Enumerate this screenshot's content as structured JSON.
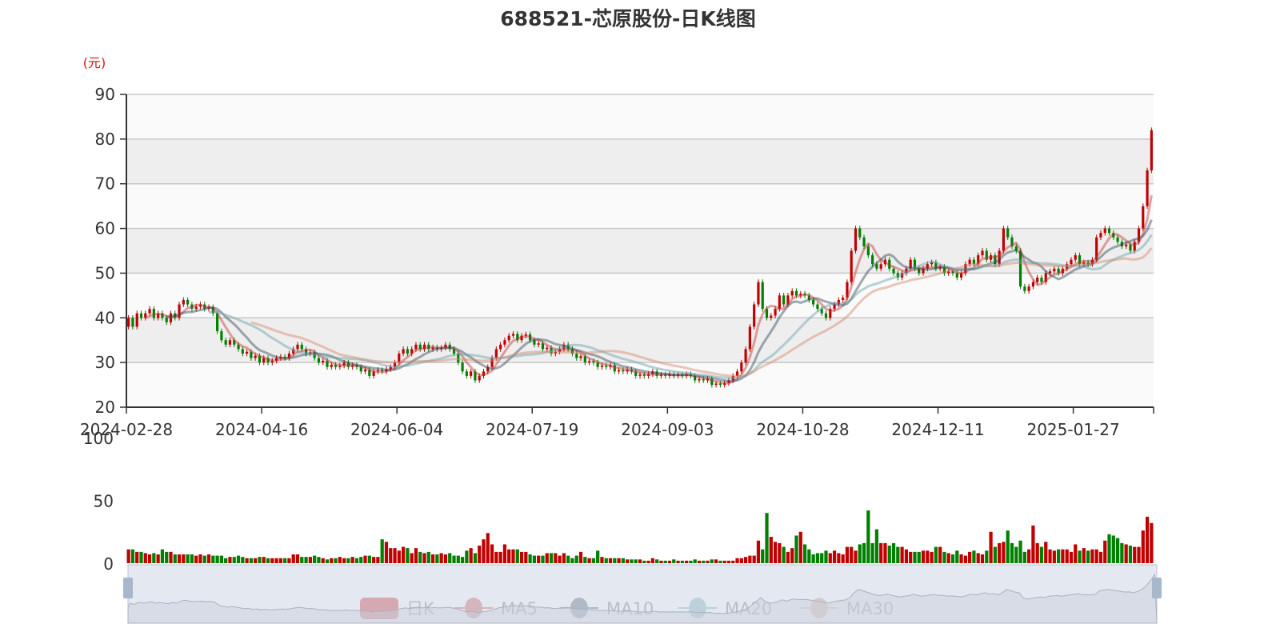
{
  "chart_data": {
    "type": "candlestick",
    "title": "688521-芯原股份-日K线图",
    "ylabel": "(元)",
    "ylim": [
      20,
      90
    ],
    "y_ticks": [
      "20",
      "30",
      "40",
      "50",
      "60",
      "70",
      "80",
      "90"
    ],
    "volume_ylim": [
      0,
      100
    ],
    "volume_ticks": [
      "0",
      "50",
      "100"
    ],
    "x_tick_labels": [
      "2024-02-28",
      "2024-04-16",
      "2024-06-04",
      "2024-07-19",
      "2024-09-03",
      "2024-10-28",
      "2024-12-11",
      "2025-01-27"
    ],
    "x_tick_interval": 32,
    "legend": [
      "日K",
      "MA5",
      "MA10",
      "MA20",
      "MA30"
    ],
    "legend_position": "bottom",
    "grid": true,
    "ma_periods": [
      5,
      10,
      20,
      30
    ],
    "close": [
      40,
      38,
      41,
      40,
      41,
      42,
      40,
      41,
      40,
      39,
      41,
      40,
      43,
      44,
      43,
      42,
      42.5,
      43,
      42,
      42.4,
      41,
      37,
      35,
      34,
      35,
      34,
      33,
      32,
      32.4,
      31,
      31.5,
      30,
      31,
      30,
      30.4,
      31,
      31.3,
      31,
      32,
      33,
      34,
      33,
      32,
      32.3,
      31,
      30,
      30.4,
      29,
      29.5,
      29,
      29.3,
      30,
      29,
      29.4,
      29,
      28,
      28.4,
      27,
      28,
      28.3,
      28,
      28.5,
      29,
      30,
      32,
      33,
      32,
      33,
      34,
      33,
      34,
      33,
      33.4,
      33,
      33.3,
      34,
      33,
      32,
      30,
      28,
      27,
      28,
      26,
      27,
      28,
      29,
      31,
      33,
      34,
      35,
      36,
      36.4,
      35,
      36,
      36.3,
      35,
      34,
      34.3,
      33,
      33.3,
      32,
      32.4,
      33,
      34,
      33,
      32,
      31,
      31.4,
      30,
      30.3,
      30,
      29,
      29.3,
      29,
      29.4,
      28,
      28.3,
      28,
      28.4,
      28,
      27,
      27.3,
      27,
      27.4,
      28,
      27,
      27.3,
      27,
      27.4,
      27,
      27.3,
      27,
      27.4,
      27,
      26,
      26.3,
      26,
      26.4,
      25,
      25.3,
      25,
      25.4,
      26,
      27,
      28,
      30,
      33,
      38,
      43,
      48,
      42,
      40,
      40.5,
      42,
      45,
      43,
      45,
      46,
      45,
      45.4,
      45,
      44,
      43,
      42,
      41,
      40,
      42,
      43,
      44,
      44.5,
      48,
      55,
      60,
      58,
      56,
      54,
      52,
      51,
      52,
      53,
      51,
      50,
      49,
      50,
      51,
      53,
      51,
      50,
      51,
      52,
      52.4,
      51,
      51.4,
      50,
      50.4,
      50,
      49,
      50,
      52,
      53,
      52,
      54,
      55,
      53,
      54,
      52,
      55,
      60,
      58,
      56,
      55,
      47,
      46,
      47,
      48,
      49,
      48,
      50,
      50.4,
      51,
      50,
      51,
      52,
      53,
      54,
      52,
      52.4,
      52,
      53,
      58,
      59,
      60,
      59,
      58,
      57,
      56,
      56.4,
      55,
      57,
      60,
      65,
      73,
      82
    ],
    "open": [
      38,
      40,
      38,
      41,
      40,
      41,
      42,
      40,
      41,
      40,
      39,
      41,
      40,
      43,
      44,
      43,
      42,
      42.5,
      43,
      42,
      42.4,
      41,
      37,
      35,
      34,
      35,
      34,
      33,
      32,
      32.4,
      31,
      31.5,
      30,
      31,
      30,
      30.4,
      31,
      31.3,
      31,
      32,
      33,
      34,
      33,
      32,
      32.3,
      31,
      30,
      30.4,
      29,
      29.5,
      29,
      29.3,
      30,
      29,
      29.4,
      29,
      28,
      28.4,
      27,
      28,
      28.3,
      28,
      28.5,
      29,
      30,
      32,
      33,
      32,
      33,
      34,
      33,
      34,
      33,
      33.4,
      33,
      33.3,
      34,
      33,
      32,
      30,
      28,
      27,
      28,
      26,
      27,
      28,
      29,
      31,
      33,
      34,
      35,
      36,
      36.4,
      35,
      36,
      36.3,
      35,
      34,
      34.3,
      33,
      33.3,
      32,
      32.4,
      33,
      34,
      33,
      32,
      31,
      31.4,
      30,
      30.3,
      30,
      29,
      29.3,
      29,
      29.4,
      28,
      28.3,
      28,
      28.4,
      28,
      27,
      27.3,
      27,
      27.4,
      28,
      27,
      27.3,
      27,
      27.4,
      27,
      27.3,
      27,
      27.4,
      27,
      26,
      26.3,
      26,
      26.4,
      25,
      25.3,
      25,
      25.4,
      26,
      27,
      28,
      30,
      33,
      38,
      43,
      48,
      42,
      40,
      40.5,
      42,
      45,
      43,
      45,
      46,
      45,
      45.4,
      45,
      44,
      43,
      42,
      41,
      40,
      42,
      43,
      44,
      44.5,
      48,
      55,
      60,
      58,
      56,
      54,
      52,
      51,
      52,
      53,
      51,
      50,
      49,
      50,
      51,
      53,
      51,
      50,
      51,
      52,
      52.4,
      51,
      51.4,
      50,
      50.4,
      50,
      49,
      50,
      52,
      53,
      52,
      54,
      55,
      53,
      54,
      52,
      55,
      60,
      58,
      56,
      55,
      47,
      46,
      47,
      48,
      49,
      48,
      50,
      50.4,
      51,
      50,
      51,
      52,
      53,
      54,
      52,
      52.4,
      52,
      53,
      58,
      59,
      60,
      59,
      58,
      57,
      56,
      56.4,
      55,
      57,
      60,
      65,
      73
    ],
    "volume": [
      11,
      11,
      9,
      9,
      8,
      7,
      8,
      7,
      11,
      9,
      9,
      7,
      7,
      7,
      7,
      7,
      6,
      7,
      6,
      7,
      6,
      6,
      6,
      4,
      5,
      5,
      6,
      5,
      4,
      4,
      4,
      5,
      5,
      4,
      4,
      4,
      4,
      4,
      4,
      7,
      7,
      5,
      5,
      5,
      6,
      5,
      4,
      3,
      4,
      4,
      5,
      4,
      4,
      5,
      4,
      5,
      6,
      6,
      5,
      5,
      19,
      17,
      12,
      12,
      10,
      13,
      12,
      8,
      12,
      9,
      8,
      9,
      7,
      7,
      8,
      7,
      8,
      6,
      6,
      5,
      10,
      12,
      8,
      14,
      19,
      24,
      15,
      9,
      9,
      15,
      11,
      11,
      11,
      9,
      9,
      7,
      6,
      6,
      6,
      8,
      8,
      8,
      6,
      8,
      6,
      4,
      6,
      9,
      5,
      4,
      4,
      10,
      5,
      4,
      4,
      4,
      4,
      4,
      3,
      3,
      3,
      3,
      2,
      2,
      4,
      3,
      2,
      2,
      2,
      3,
      2,
      2,
      2,
      2,
      3,
      2,
      2,
      2,
      3,
      3,
      2,
      2,
      2,
      2,
      4,
      4,
      5,
      6,
      6,
      18,
      11,
      40,
      21,
      17,
      16,
      13,
      9,
      12,
      22,
      25,
      15,
      11,
      7,
      8,
      8,
      10,
      8,
      10,
      8,
      7,
      13,
      13,
      10,
      15,
      16,
      42,
      16,
      27,
      16,
      16,
      14,
      16,
      13,
      13,
      11,
      9,
      9,
      9,
      10,
      10,
      9,
      13,
      13,
      9,
      8,
      7,
      10,
      7,
      6,
      9,
      10,
      8,
      7,
      10,
      25,
      13,
      16,
      17,
      26,
      16,
      13,
      18,
      9,
      11,
      30,
      16,
      13,
      17,
      11,
      10,
      11,
      11,
      11,
      9,
      15,
      10,
      12,
      10,
      11,
      11,
      9,
      18,
      23,
      22,
      20,
      16,
      15,
      14,
      13,
      13,
      26,
      37,
      32
    ],
    "colors": {
      "up": "#c00000",
      "down": "#008000",
      "ma5": "#c23531",
      "ma10": "#2f4554",
      "ma20": "#61a0a8",
      "ma30": "#d48265",
      "slider": "#dbe2ec"
    }
  }
}
